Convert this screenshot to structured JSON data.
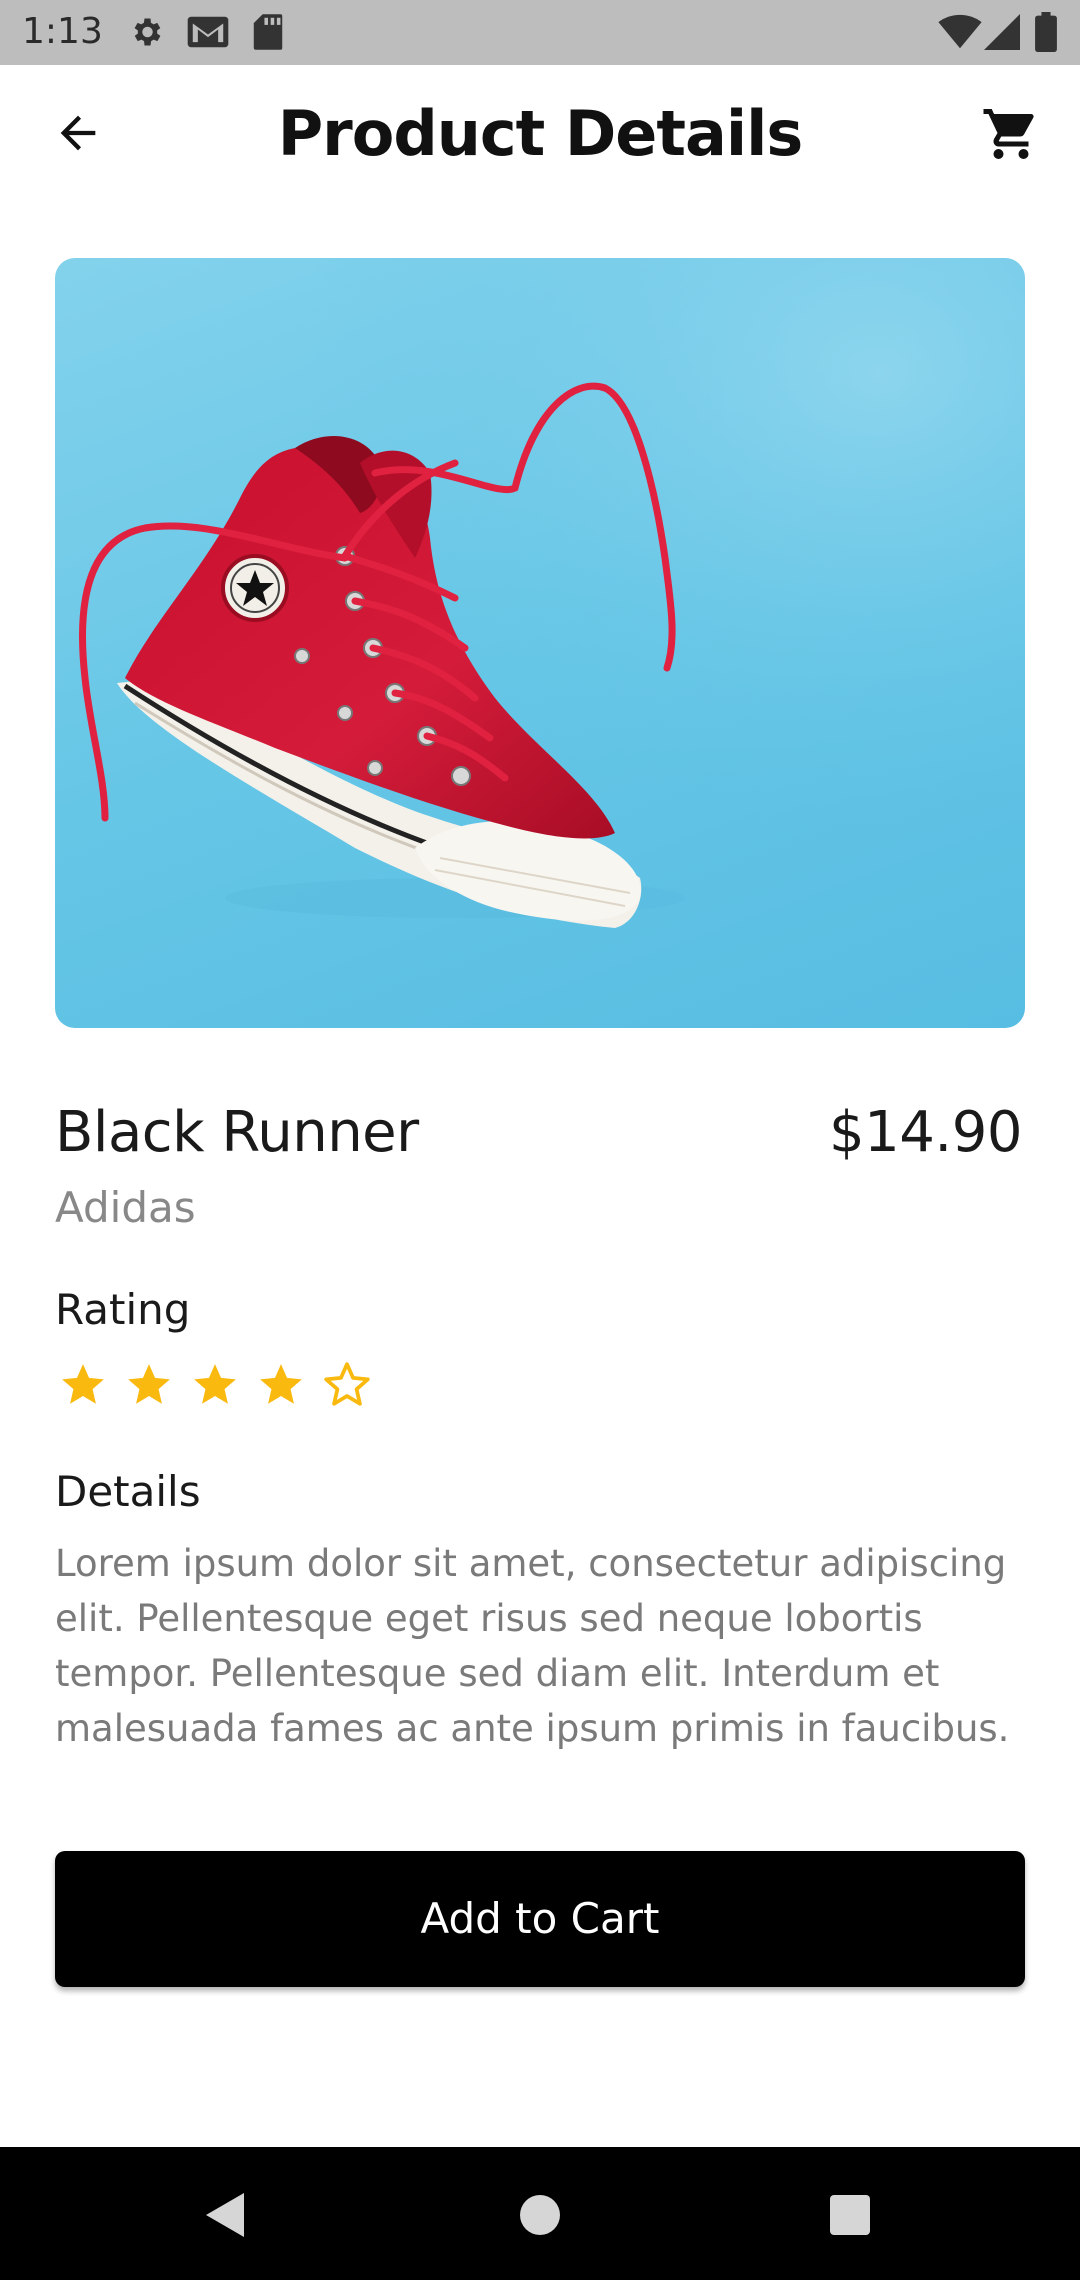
{
  "status_bar": {
    "time": "1:13",
    "icons": [
      "gear-icon",
      "gmail-icon",
      "sd-card-icon",
      "wifi-icon",
      "cell-signal-icon",
      "battery-icon"
    ]
  },
  "app_bar": {
    "title": "Product Details",
    "back_icon": "arrow-back-icon",
    "cart_icon": "shopping-cart-icon"
  },
  "product": {
    "name": "Black Runner",
    "price": "$14.90",
    "brand": "Adidas",
    "image_alt": "Red high-top sneaker on a light blue background",
    "rating_label": "Rating",
    "rating": 4,
    "rating_max": 5,
    "details_label": "Details",
    "details": "Lorem ipsum dolor sit amet, consectetur adipiscing elit. Pellentesque eget risus sed neque lobortis tempor. Pellentesque sed diam elit. Interdum et malesuada fames ac ante ipsum primis in faucibus."
  },
  "actions": {
    "add_to_cart": "Add to Cart"
  },
  "colors": {
    "star": "#f9b90f",
    "image_background": "#66c6e6",
    "button_background": "#000000",
    "status_bar": "#bdbdbd"
  },
  "nav_bar": {
    "icons": [
      "nav-back-icon",
      "nav-home-icon",
      "nav-recents-icon"
    ]
  }
}
